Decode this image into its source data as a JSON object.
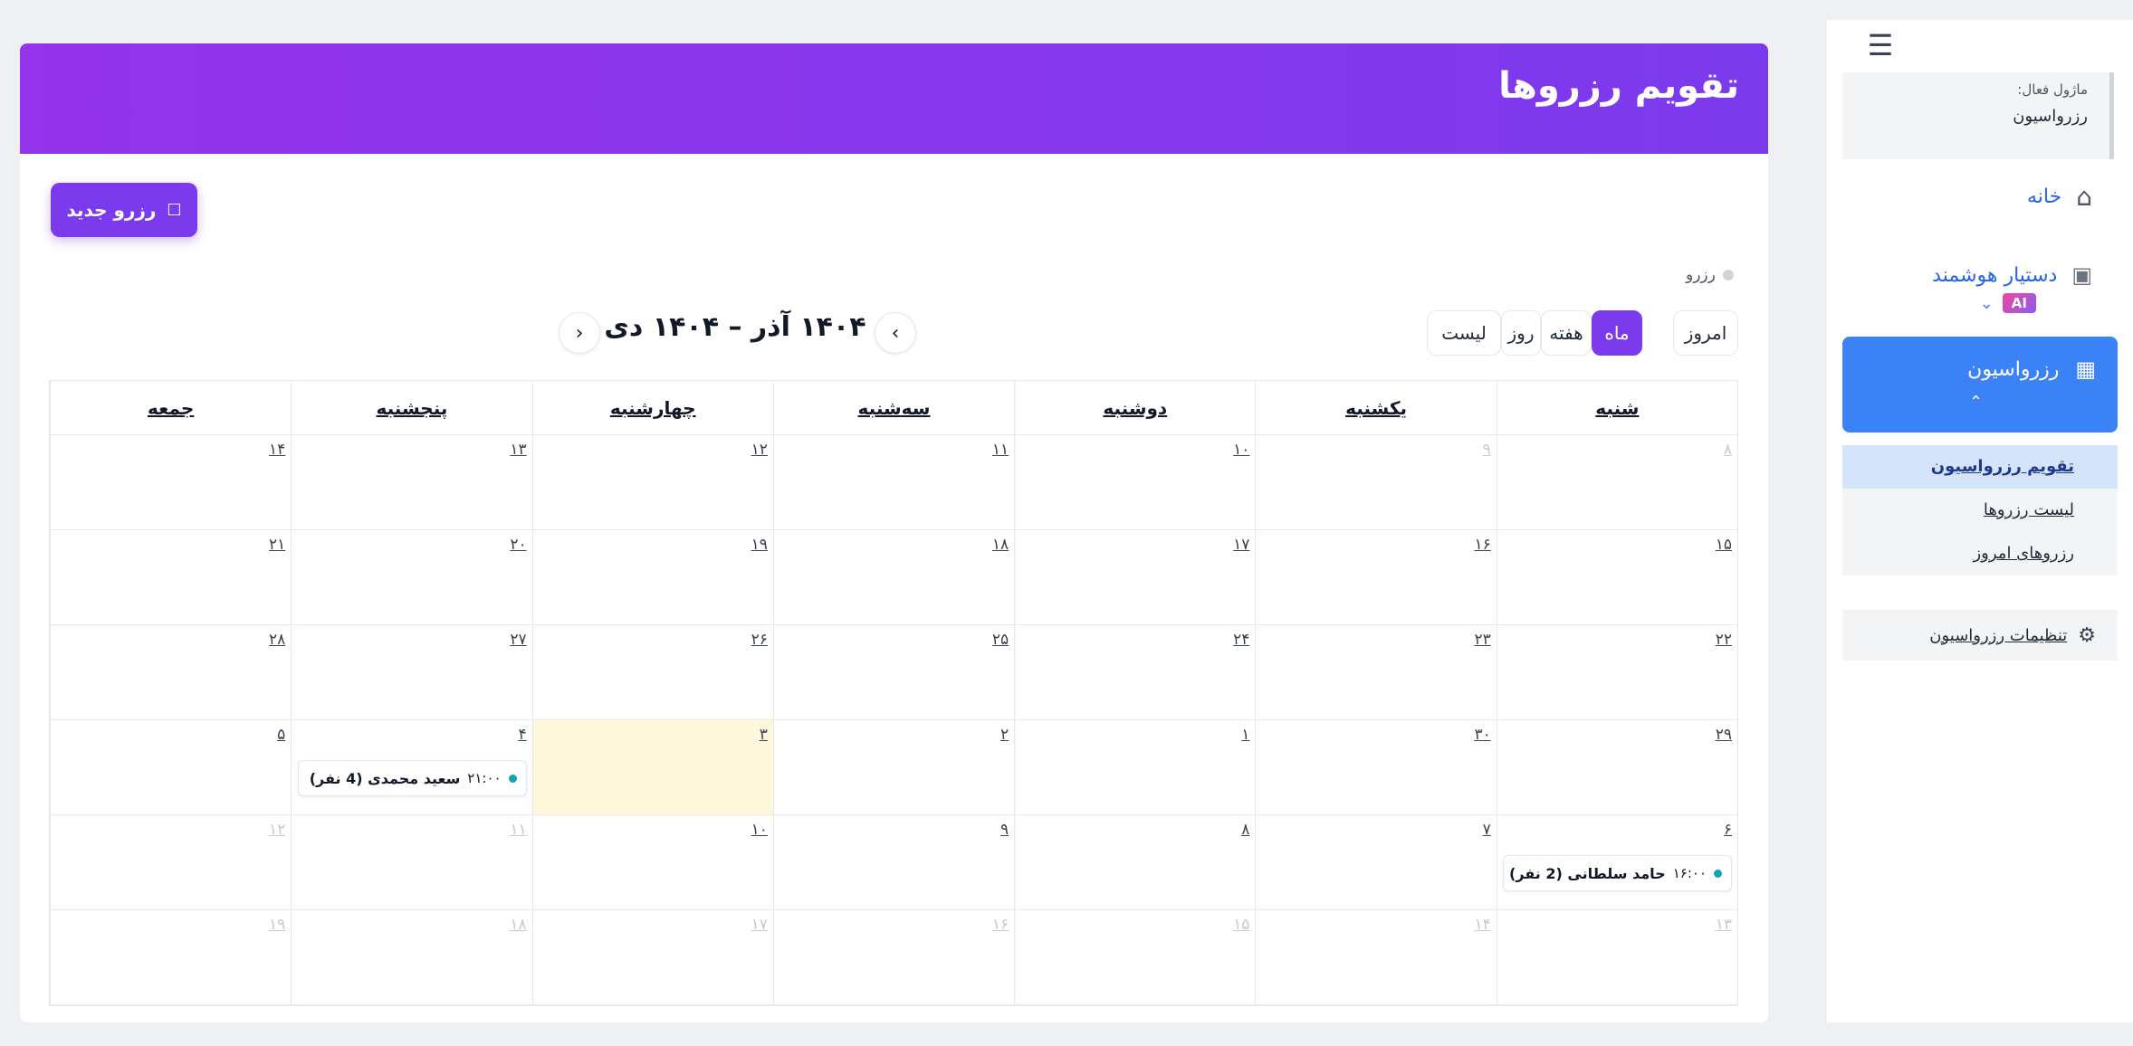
{
  "sidebar": {
    "module_label": "ماژول فعال:",
    "module_value": "رزرواسیون",
    "home": "خانه",
    "ai_assistant": "دستیار هوشمند",
    "ai_badge": "AI",
    "reservations": "رزرواسیون",
    "submenu": [
      "تقویم رزرواسیون",
      "لیست رزروها",
      "رزروهای امروز"
    ],
    "settings": "تنظیمات رزرواسیون"
  },
  "main": {
    "title": "تقویم رزروها",
    "new_button": "رزرو جدید",
    "legend_label": "رزرو",
    "range_title": "۱۴۰۴ آذر – ۱۴۰۴ دی",
    "views": {
      "today": "امروز",
      "month": "ماه",
      "week": "هفته",
      "day": "روز",
      "list": "لیست"
    },
    "active_view": "month"
  },
  "calendar": {
    "weekdays": [
      "شنبه",
      "یکشنبه",
      "دوشنبه",
      "سه‌شنبه",
      "چهارشنبه",
      "پنجشنبه",
      "جمعه"
    ],
    "weeks": [
      [
        "۸",
        "۹",
        "۱۰",
        "۱۱",
        "۱۲",
        "۱۳",
        "۱۴"
      ],
      [
        "۱۵",
        "۱۶",
        "۱۷",
        "۱۸",
        "۱۹",
        "۲۰",
        "۲۱"
      ],
      [
        "۲۲",
        "۲۳",
        "۲۴",
        "۲۵",
        "۲۶",
        "۲۷",
        "۲۸"
      ],
      [
        "۲۹",
        "۳۰",
        "۱",
        "۲",
        "۳",
        "۴",
        "۵"
      ],
      [
        "۶",
        "۷",
        "۸",
        "۹",
        "۱۰",
        "۱۱",
        "۱۲"
      ],
      [
        "۱۳",
        "۱۴",
        "۱۵",
        "۱۶",
        "۱۷",
        "۱۸",
        "۱۹"
      ]
    ],
    "other_month_cells": [
      [
        0,
        0
      ],
      [
        0,
        1
      ],
      [
        4,
        5
      ],
      [
        4,
        6
      ],
      [
        5,
        0
      ],
      [
        5,
        1
      ],
      [
        5,
        2
      ],
      [
        5,
        3
      ],
      [
        5,
        4
      ],
      [
        5,
        5
      ],
      [
        5,
        6
      ]
    ],
    "today_cell": [
      3,
      4
    ],
    "events": [
      {
        "week": 3,
        "day": 5,
        "time": "۲۱:۰۰",
        "title": "سعید محمدی (4 نفر)"
      },
      {
        "week": 4,
        "day": 0,
        "time": "۱۶:۰۰",
        "title": "حامد سلطانی (2 نفر)"
      }
    ],
    "event_color": "#0ea5b7",
    "today_color": "#fef7dc"
  },
  "colors": {
    "primary": "#7c3aed",
    "sidebar_active": "#3b82f6"
  }
}
